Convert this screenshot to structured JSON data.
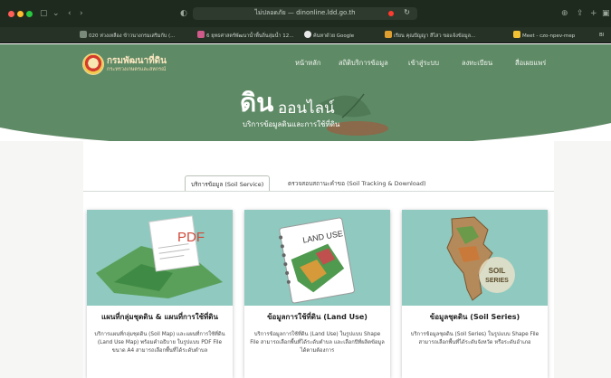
{
  "browser": {
    "url": "ไม่ปลอดภัย — dinonline.ldd.go.th",
    "bookmarks": [
      "020 ห่วงเหลือง ข้าวนางกรมเสริมกับ (...",
      "6 ยุทธศาสตร์พัฒนาน้ำพื้นถิ่นลุ่มน้ำ 12...",
      "ค้นหาด้วย Google",
      "เรียน คุณปัญญา สีไสว ขอแจ้งข้อมูล...",
      "Meet - czo-npev-mep",
      "Bl"
    ]
  },
  "site": {
    "logo_title": "กรมพัฒนาที่ดิน",
    "logo_subtitle": "กระทรวงเกษตรและสหกรณ์",
    "nav": [
      "หน้าหลัก",
      "สถิติบริการข้อมูล",
      "เข้าสู่ระบบ",
      "ลงทะเบียน",
      "สื่อเผยแพร่"
    ]
  },
  "hero": {
    "title_main": "ดิน",
    "title_rest": "ออนไลน์",
    "subtitle": "บริการข้อมูลดินและการใช้ที่ดิน"
  },
  "tabs": [
    {
      "label": "บริการข้อมูล (Soil Service)",
      "active": true
    },
    {
      "label": "ตรวจสอบสถานะคำขอ (Soil Tracking & Download)",
      "active": false
    }
  ],
  "cards": [
    {
      "title": "แผนที่กลุ่มชุดดิน & แผนที่การใช้ที่ดิน",
      "description": "บริการแผนที่กลุ่มชุดดิน (Soil Map) และแผนที่การใช้ที่ดิน (Land Use Map) พร้อมคำอธิบาย ในรูปแบบ PDF File ขนาด A4 สามารถเลือกพื้นที่ได้ระดับตำบล",
      "image_label": "PDF"
    },
    {
      "title": "ข้อมูลการใช้ที่ดิน (Land Use)",
      "description": "บริการข้อมูลการใช้ที่ดิน (Land Use) ในรูปแบบ Shape File สามารถเลือกพื้นที่ได้ระดับตำบล และเลือกปีที่ผลิตข้อมูลได้ตามต้องการ",
      "image_label": "LAND USE"
    },
    {
      "title": "ข้อมูลชุดดิน (Soil Series)",
      "description": "บริการข้อมูลชุดดิน (Soil Series) ในรูปแบบ Shape File สามารถเลือกพื้นที่ได้ระดับจังหวัด หรือระดับอำเภอ",
      "image_label": "SOIL SERIES"
    }
  ],
  "colors": {
    "header_green": "#5f8a66",
    "card_bg": "#8fc9bf",
    "logo_text": "#fbe7c0"
  }
}
